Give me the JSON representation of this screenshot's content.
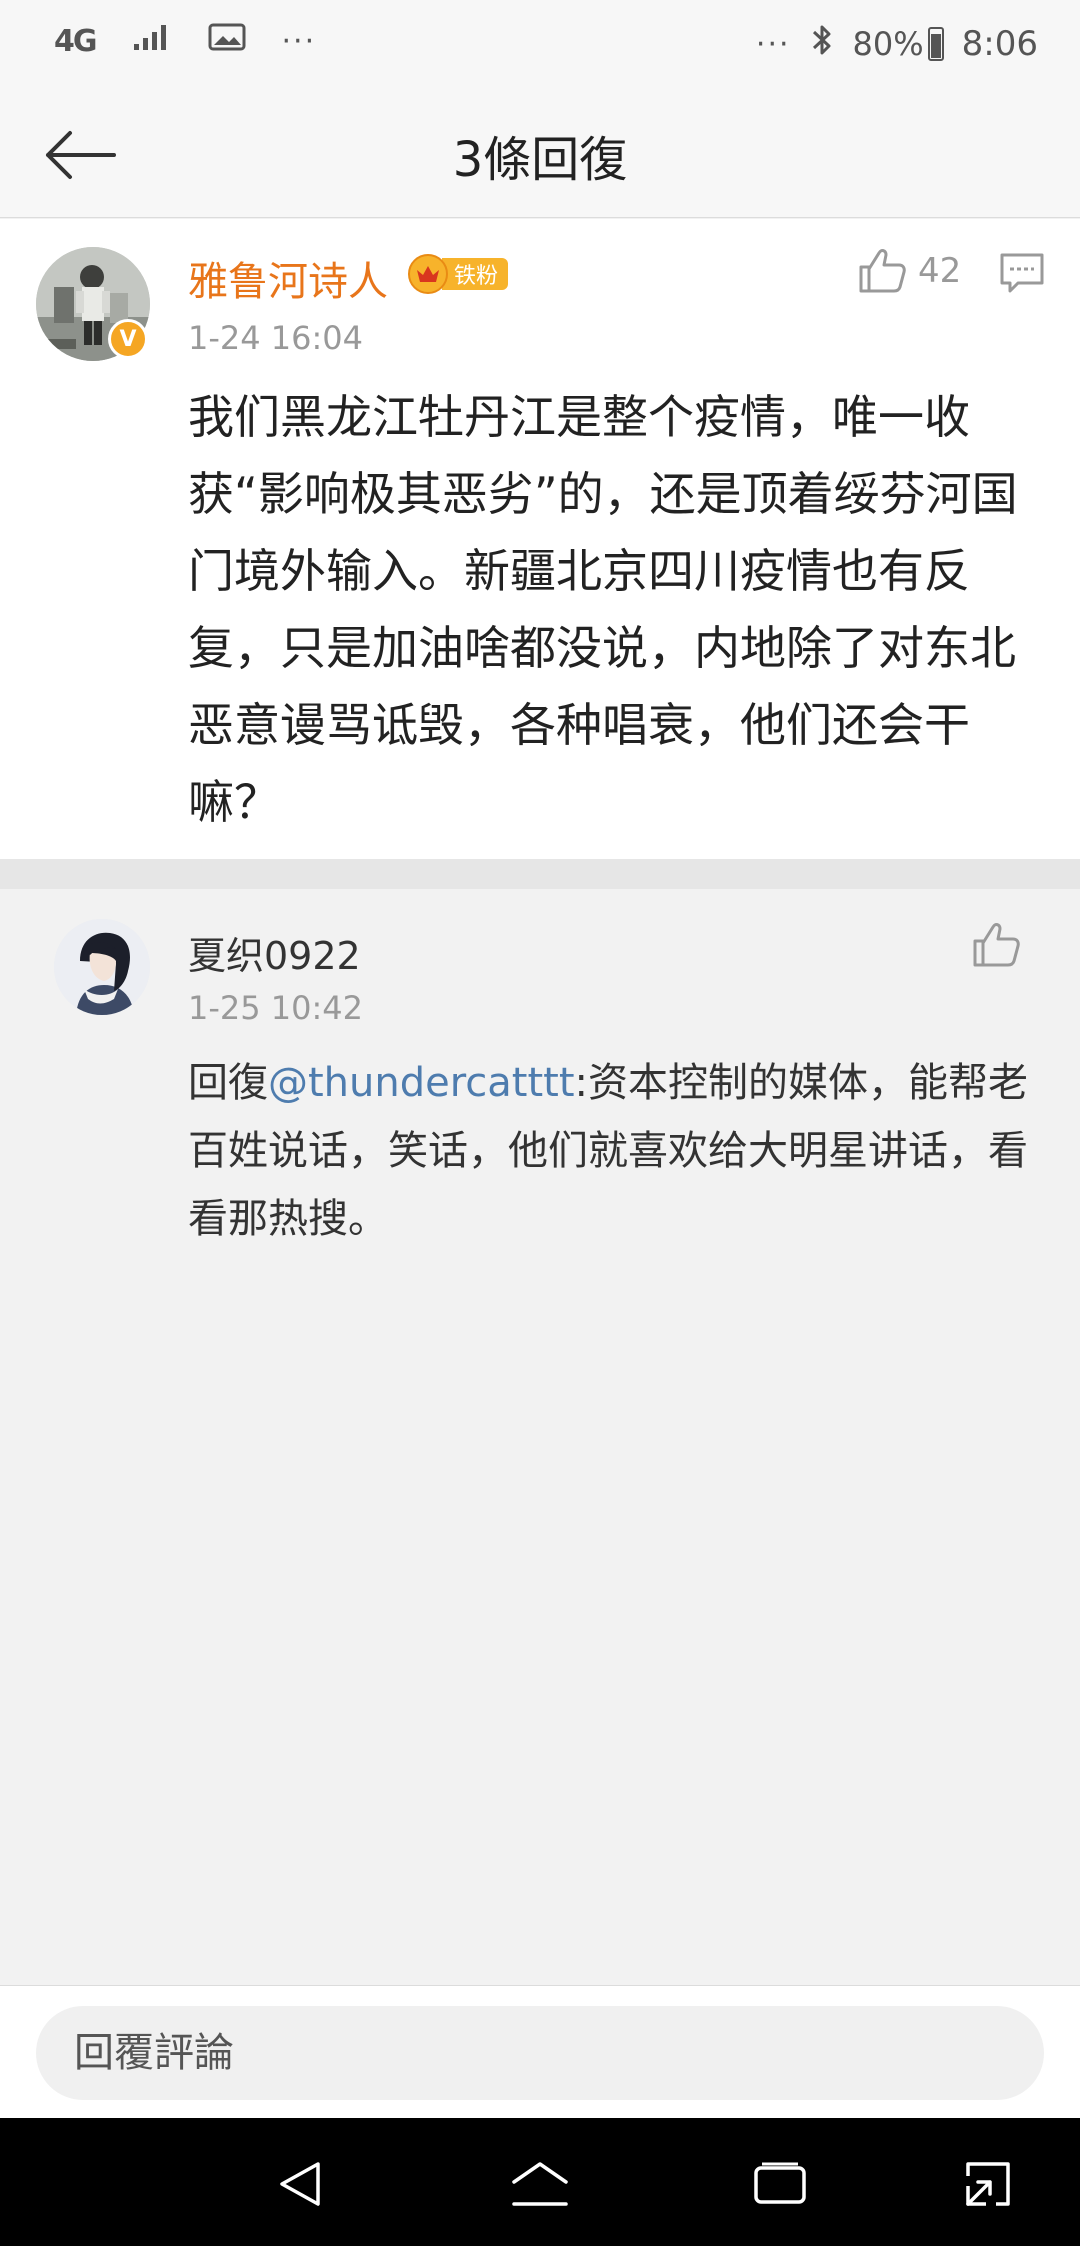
{
  "status_bar": {
    "network": "4G",
    "more": "···",
    "more_right": "···",
    "battery": "80%",
    "battery_level": 0.8,
    "time": "8:06"
  },
  "header": {
    "title": "3條回復"
  },
  "main_comment": {
    "author": "雅鲁河诗人",
    "fan_badge": "铁粉",
    "verified_mark": "V",
    "time": "1-24 16:04",
    "like_count": "42",
    "text": "我们黑龙江牡丹江是整个疫情，唯一收获“影响极其恶劣”的，还是顶着绥芬河国门境外输入。新疆北京四川疫情也有反复，只是加油啥都没说，内地除了对东北恶意谩骂诋毁，各种唱衰，他们还会干嘛？"
  },
  "reply": {
    "author": "夏织0922",
    "time": "1-25 10:42",
    "prefix": "回復",
    "mention": "@thundercatttt",
    "text": ":资本控制的媒体，能帮老百姓说话，笑话，他们就喜欢给大明星讲话，看看那热搜。"
  },
  "input": {
    "placeholder": "回覆評論"
  },
  "colors": {
    "author_orange": "#e8751a",
    "mention_blue": "#4e7cae",
    "badge_gold": "#f7b32b"
  },
  "icons": [
    "back-arrow-icon",
    "like-icon",
    "comment-icon",
    "back-nav-icon",
    "home-nav-icon",
    "recents-nav-icon",
    "rotate-nav-icon"
  ]
}
